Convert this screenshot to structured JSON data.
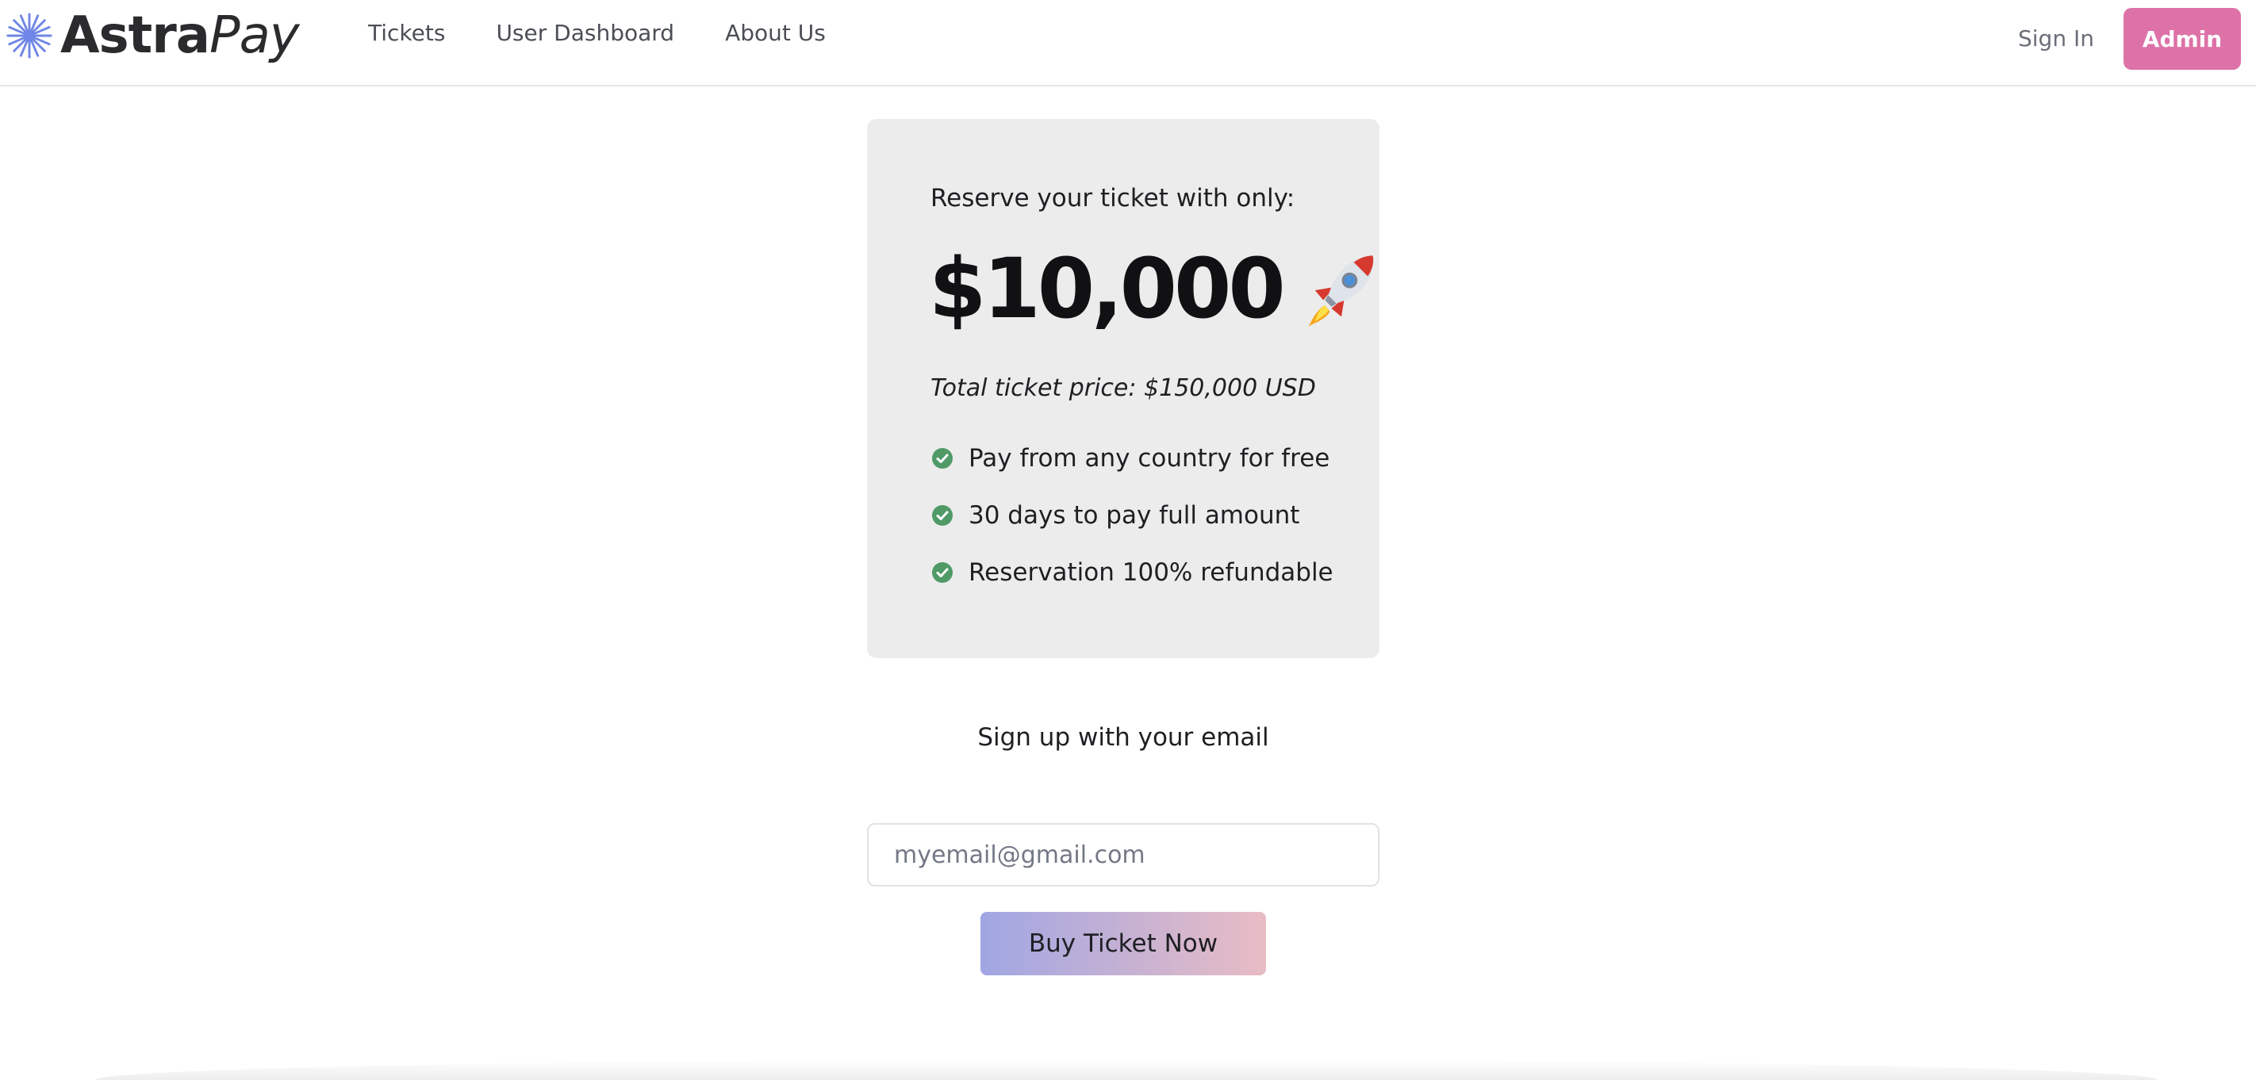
{
  "brand": {
    "name_part1": "Astra",
    "name_part2": "Pay",
    "accent_color": "#dd72a8",
    "logo_icon": "starburst-icon"
  },
  "nav": {
    "links": [
      {
        "label": "Tickets"
      },
      {
        "label": "User Dashboard"
      },
      {
        "label": "About Us"
      }
    ],
    "sign_in": "Sign In",
    "admin": "Admin"
  },
  "card": {
    "lead": "Reserve your ticket with only:",
    "price": "$10,000",
    "price_icon": "rocket-icon",
    "total": "Total ticket price: $150,000 USD",
    "features": [
      {
        "text": "Pay from any country for free",
        "icon": "check-circle-icon"
      },
      {
        "text": "30 days to pay full amount",
        "icon": "check-circle-icon"
      },
      {
        "text": "Reservation 100% refundable",
        "icon": "check-circle-icon"
      }
    ],
    "check_color": "#4f9a67"
  },
  "signup": {
    "label": "Sign up with your email",
    "email_placeholder": "myemail@gmail.com",
    "email_value": "",
    "buy_button": "Buy Ticket Now",
    "button_gradient": [
      "#a0a6e3",
      "#e9bcc4"
    ]
  }
}
